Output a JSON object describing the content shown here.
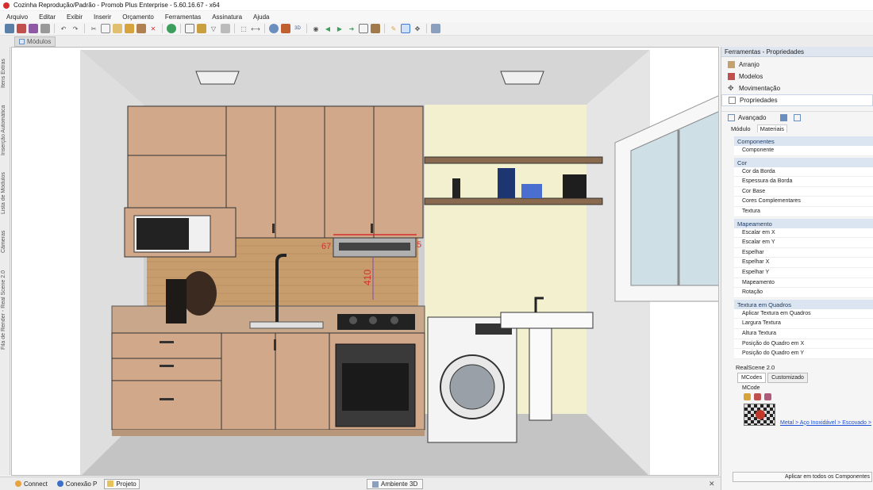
{
  "window": {
    "title": "Cozinha Reprodução/Padrão - Promob Plus Enterprise - 5.60.16.67 - x64"
  },
  "menu": [
    "Arquivo",
    "Editar",
    "Exibir",
    "Inserir",
    "Orçamento",
    "Ferramentas",
    "Assinatura",
    "Ajuda"
  ],
  "toolbar": {
    "icons": [
      "save-icon",
      "print-icon",
      "print-preview-icon",
      "print-setup-icon",
      "undo-icon",
      "redo-icon",
      "cut-icon",
      "copy-icon",
      "paste-icon",
      "paint-icon",
      "brush-icon",
      "delete-icon",
      "refresh-icon",
      "frame-icon",
      "layers-icon",
      "polygon-icon",
      "grid-icon",
      "select-icon",
      "measure-icon",
      "shield-icon",
      "texture-icon",
      "3d-icon",
      "eye-icon",
      "rotate-left-icon",
      "rotate-right-icon",
      "arrow-right-icon",
      "box-icon",
      "cube-icon",
      "pencil-icon",
      "render-icon",
      "move-icon",
      "settings-icon"
    ]
  },
  "tabs": {
    "modulos": "Módulos"
  },
  "left_strip": [
    "Itens Extras",
    "Inserção Automática",
    "Lista de Módulos",
    "Câmeras",
    "Fila de Render - Real Scene 2.0"
  ],
  "viewport": {
    "dimension_height": "410",
    "dimension_left": "67",
    "dimension_right": "5"
  },
  "properties": {
    "header": "Ferramentas - Propriedades",
    "nav": [
      "Arranjo",
      "Modelos",
      "Movimentação",
      "Propriedades"
    ],
    "avancado": "Avançado",
    "subtabs": [
      "Módulo",
      "Materiais"
    ],
    "groups": [
      {
        "name": "Componentes",
        "items": [
          "Componente"
        ]
      },
      {
        "name": "Cor",
        "items": [
          "Cor da Borda",
          "Espessura da Borda",
          "Cor Base",
          "Cores Complementares",
          "Textura"
        ]
      },
      {
        "name": "Mapeamento",
        "items": [
          "Escalar em X",
          "Escalar em Y",
          "Espelhar",
          "Espelhar X",
          "Espelhar Y",
          "Mapeamento",
          "Rotação"
        ]
      },
      {
        "name": "Textura em Quadros",
        "items": [
          "Aplicar Textura em Quadros",
          "Largura Textura",
          "Altura Textura",
          "Posição do Quadro em X",
          "Posição do Quadro em Y"
        ]
      }
    ],
    "realscene": "RealScene 2.0",
    "rs_tabs": [
      "MCodes",
      "Customizado"
    ],
    "mcode_label": "MCode",
    "material_link": "Metal > Aço Inoxidável > Escovado >",
    "apply_button": "Aplicar em todos os Componentes"
  },
  "status": {
    "connect": "Connect",
    "conexao": "Conexão P",
    "projeto": "Projeto",
    "ambiente": "Ambiente 3D"
  },
  "colors": {
    "cabinet": "#d2a88a",
    "wall": "#f2f0cf",
    "tile": "#c89d6e",
    "accent_red": "#d32f2f"
  }
}
